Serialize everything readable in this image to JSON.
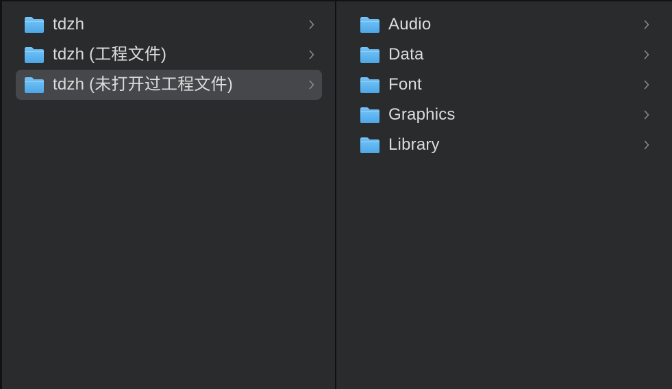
{
  "left_column": {
    "items": [
      {
        "label": "tdzh",
        "icon": "folder-icon",
        "selected": false
      },
      {
        "label": "tdzh (工程文件)",
        "icon": "folder-icon",
        "selected": false
      },
      {
        "label": "tdzh (未打开过工程文件)",
        "icon": "folder-icon",
        "selected": true
      }
    ]
  },
  "right_column": {
    "items": [
      {
        "label": "Audio",
        "icon": "folder-icon"
      },
      {
        "label": "Data",
        "icon": "folder-icon"
      },
      {
        "label": "Font",
        "icon": "folder-icon"
      },
      {
        "label": "Graphics",
        "icon": "folder-icon"
      },
      {
        "label": "Library",
        "icon": "folder-icon"
      }
    ]
  },
  "colors": {
    "background": "#2a2b2d",
    "selection": "#46474a",
    "text": "#dcdcdc",
    "folder_blue": "#5cb3f0"
  }
}
